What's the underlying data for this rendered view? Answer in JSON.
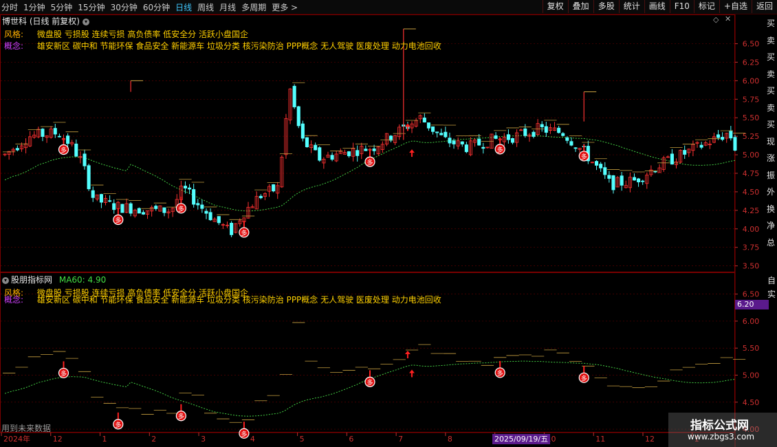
{
  "toolbar": {
    "periods": [
      "分时",
      "1分钟",
      "5分钟",
      "15分钟",
      "30分钟",
      "60分钟",
      "日线",
      "周线",
      "月线",
      "多周期",
      "更多 >"
    ],
    "active_index": 6,
    "actions": [
      "复权",
      "叠加",
      "多股",
      "统计",
      "画线",
      "F10",
      "标记",
      "+自选",
      "返回"
    ]
  },
  "main_panel": {
    "title": "博世科 (日线 前复权)",
    "style_label": "风格:",
    "style_text": "微盘股 亏损股 连续亏损 高负债率 低安全分 活跃小盘国企",
    "concept_label": "概念:",
    "concept_text": "雄安新区 碳中和 节能环保 食品安全 新能源车 垃圾分类 核污染防治 PPP概念 无人驾驶 医废处理 动力电池回收",
    "y_ticks": [
      "6.50",
      "6.25",
      "6.00",
      "5.75",
      "5.50",
      "5.25",
      "5.00",
      "4.75",
      "4.50",
      "4.25",
      "4.00",
      "3.75",
      "3.50"
    ]
  },
  "lower_panel": {
    "title": "股朋指标网",
    "ma_label": "MA60: 4.90",
    "style_label": "风格:",
    "style_text": "微盘股 亏损股 连续亏损 高负债率 低安全分 活跃小盘国企",
    "concept_label": "概念:",
    "concept_text": "雄安新区 碳中和 节能环保 食品安全 新能源车 垃圾分类 核污染防治 PPP概念 无人驾驶 医废处理 动力电池回收",
    "y_ticks": [
      "6.50",
      "6.00",
      "5.50",
      "5.00",
      "4.50",
      "4.00"
    ],
    "price_tag": "6.20",
    "footer": "用到未来数据"
  },
  "right_strip": {
    "chars": [
      "买",
      "卖",
      "买",
      "卖",
      "买",
      "卖",
      "买",
      "现",
      "涨",
      "振",
      "外",
      "换",
      "净",
      "总"
    ],
    "lower_chars": [
      "自",
      "实"
    ]
  },
  "date_axis": {
    "labels": [
      "2024年",
      "12",
      "1",
      "2",
      "3",
      "4",
      "5",
      "6",
      "7",
      "8",
      "9",
      "10",
      "11",
      "12",
      "1"
    ],
    "cursor_date": "2025/09/19/五"
  },
  "watermark": {
    "line1": "指标公式网",
    "line2": "www.zbgs3.com"
  },
  "colors": {
    "up": "#ff3232",
    "down": "#54ffff",
    "ma": "#44d144",
    "level": "#c8a040"
  },
  "chart_data": {
    "type": "candlestick",
    "title": "博世科 (日线 前复权)",
    "ma60_last": 4.9,
    "price_range_main": [
      3.45,
      6.7
    ],
    "signal_positions": [
      14,
      27,
      42,
      57,
      87,
      118,
      138
    ]
  }
}
